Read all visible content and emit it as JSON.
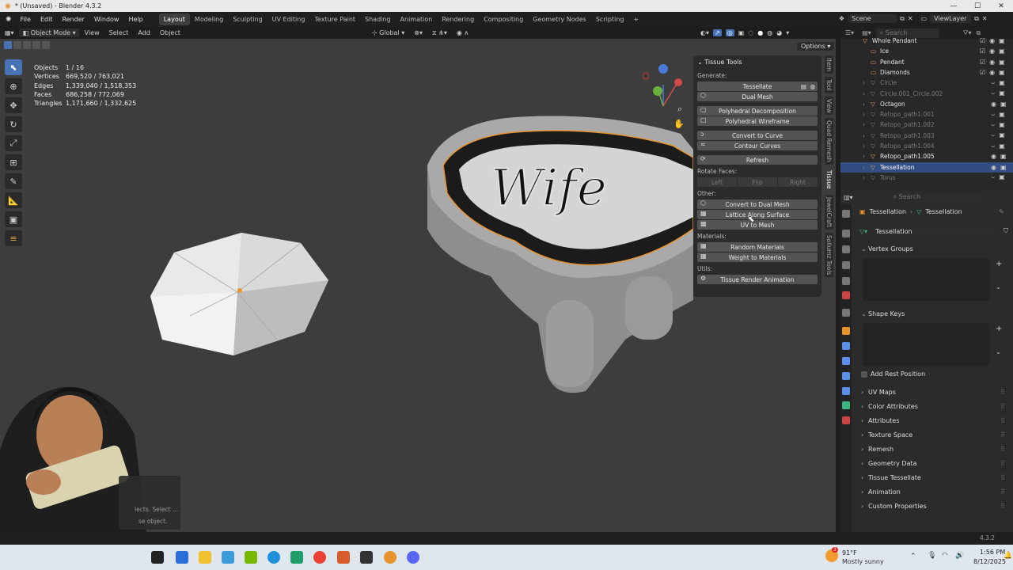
{
  "window": {
    "title": "* (Unsaved) - Blender 4.3.2",
    "controls": [
      "—",
      "☐",
      "✕"
    ]
  },
  "menu": [
    "File",
    "Edit",
    "Render",
    "Window",
    "Help"
  ],
  "workspaces": [
    "Layout",
    "Modeling",
    "Sculpting",
    "UV Editing",
    "Texture Paint",
    "Shading",
    "Animation",
    "Rendering",
    "Compositing",
    "Geometry Nodes",
    "Scripting",
    "+"
  ],
  "active_workspace": "Layout",
  "scene": {
    "name": "Scene",
    "view_layer": "ViewLayer"
  },
  "header": {
    "mode": "Object Mode",
    "items": [
      "View",
      "Select",
      "Add",
      "Object"
    ],
    "transform": "Global",
    "options": "Options"
  },
  "stats": [
    {
      "k": "Objects",
      "v": "1 / 16"
    },
    {
      "k": "Vertices",
      "v": "669,520 / 763,021"
    },
    {
      "k": "Edges",
      "v": "1,339,040 / 1,518,353"
    },
    {
      "k": "Faces",
      "v": "686,258 / 772,069"
    },
    {
      "k": "Triangles",
      "v": "1,171,660 / 1,332,625"
    }
  ],
  "tissue": {
    "title": "Tissue Tools",
    "generate_label": "Generate:",
    "generate": [
      "Tessellate",
      "Dual Mesh",
      "Polyhedral Decomposition",
      "Polyhedral Wireframe",
      "Convert to Curve",
      "Contour Curves",
      "Refresh"
    ],
    "rotate_label": "Rotate Faces:",
    "rotate": [
      "Left",
      "Flip",
      "Right"
    ],
    "other_label": "Other:",
    "other": [
      "Convert to Dual Mesh",
      "Lattice Along Surface",
      "UV to Mesh"
    ],
    "materials_label": "Materials:",
    "materials": [
      "Random Materials",
      "Weight to Materials"
    ],
    "utils_label": "Utils:",
    "utils": [
      "Tissue Render Animation"
    ]
  },
  "side_tabs": [
    "Item",
    "Tool",
    "View",
    "Quad Remesh",
    "Tissue",
    "JewelCraft",
    "Sollumz Tools"
  ],
  "outliner": {
    "search_placeholder": "Search",
    "rows": [
      {
        "name": "Whole Pendant",
        "dim": false,
        "sel": false
      },
      {
        "name": "Ice",
        "dim": false,
        "sel": false
      },
      {
        "name": "Pendant",
        "dim": false,
        "sel": false
      },
      {
        "name": "Diamonds",
        "dim": false,
        "sel": false
      },
      {
        "name": "Circle",
        "dim": true,
        "sel": false
      },
      {
        "name": "Circle.001_Circle.002",
        "dim": true,
        "sel": false
      },
      {
        "name": "Octagon",
        "dim": false,
        "sel": false
      },
      {
        "name": "Retopo_path1.001",
        "dim": true,
        "sel": false
      },
      {
        "name": "Retopo_path1.002",
        "dim": true,
        "sel": false
      },
      {
        "name": "Retopo_path1.003",
        "dim": true,
        "sel": false
      },
      {
        "name": "Retopo_path1.004",
        "dim": true,
        "sel": false
      },
      {
        "name": "Retopo_path1.005",
        "dim": false,
        "sel": false
      },
      {
        "name": "Tessellation",
        "dim": false,
        "sel": true
      },
      {
        "name": "Torus",
        "dim": true,
        "sel": false
      }
    ]
  },
  "properties": {
    "search_placeholder": "Search",
    "breadcrumb": [
      "Tessellation",
      "Tessellation"
    ],
    "data_name": "Tessellation",
    "sections_top": [
      "Vertex Groups",
      "Shape Keys"
    ],
    "add_rest": "Add Rest Position",
    "sections": [
      "UV Maps",
      "Color Attributes",
      "Attributes",
      "Texture Space",
      "Remesh",
      "Geometry Data",
      "Tissue Tessellate",
      "Animation",
      "Custom Properties"
    ]
  },
  "status": {
    "hint1": "lects. Select ...",
    "hint2": "se object.",
    "version": "4.3.2"
  },
  "taskbar": {
    "weather_temp": "91°F",
    "weather_desc": "Mostly sunny",
    "weather_badge": "3",
    "time": "1:56 PM",
    "date": "8/12/2025"
  },
  "colors": {
    "accent": "#4772b3",
    "selection": "#334d80",
    "orange": "#e8942e"
  }
}
